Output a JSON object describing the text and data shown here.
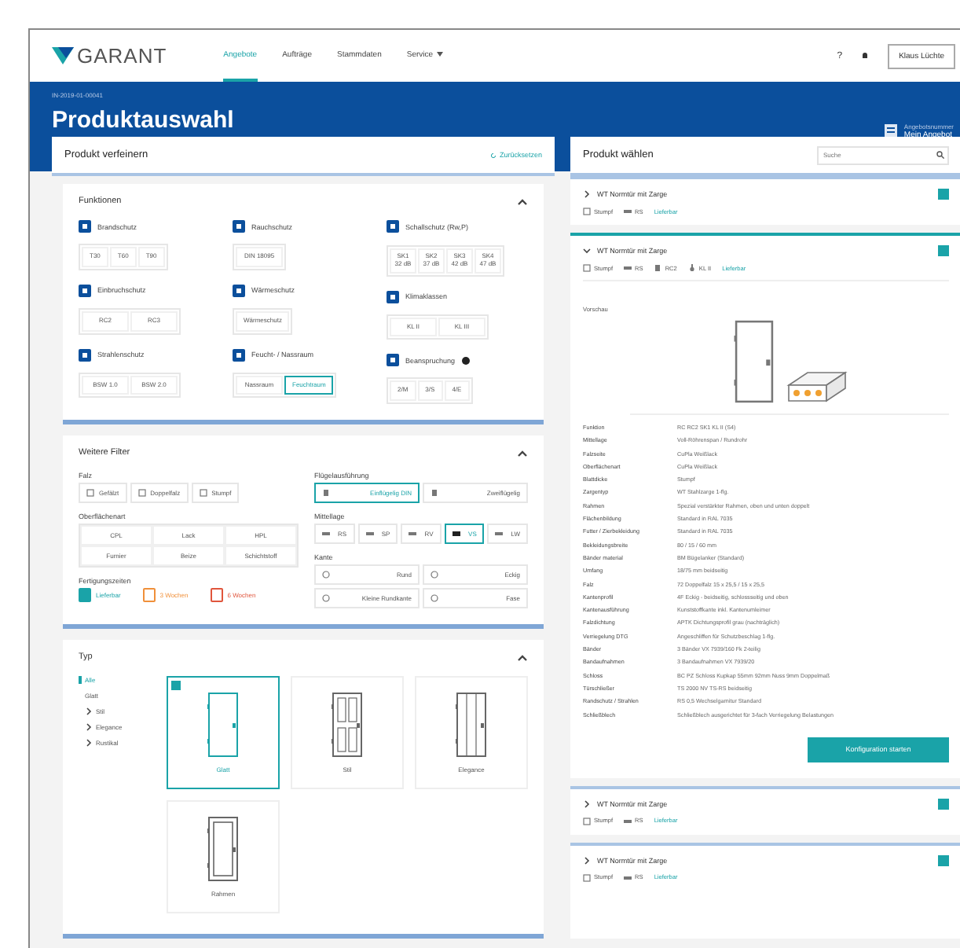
{
  "nav": {
    "logo": "GARANT",
    "items": [
      {
        "label": "Angebote",
        "selected": true,
        "menu": false
      },
      {
        "label": "Aufträge",
        "selected": false,
        "menu": false
      },
      {
        "label": "Stammdaten",
        "selected": false,
        "menu": false
      },
      {
        "label": "Service",
        "selected": false,
        "menu": true
      }
    ],
    "help": "?",
    "user": "Klaus Lüchte"
  },
  "header": {
    "breadcrumb": "IN-2019-01-00041",
    "title": "Produktauswahl",
    "offer_label": "Angebotsnummer",
    "offer_name": "Mein Angebot"
  },
  "refine": {
    "title": "Produkt verfeinern",
    "reset": "Zurücksetzen",
    "functions": {
      "title": "Funktionen",
      "expanded": true,
      "columns": [
        [
          {
            "label": "Brandschutz",
            "options": [
              {
                "label": "T30",
                "selected": false
              },
              {
                "label": "T60",
                "selected": false
              },
              {
                "label": "T90",
                "selected": false
              }
            ]
          },
          {
            "label": "Einbruchschutz",
            "options": [
              {
                "label": "RC2",
                "selected": false
              },
              {
                "label": "RC3",
                "selected": false
              }
            ]
          },
          {
            "label": "Strahlenschutz",
            "options": [
              {
                "label": "BSW 1.0",
                "selected": false
              },
              {
                "label": "BSW 2.0",
                "selected": false
              }
            ]
          }
        ],
        [
          {
            "label": "Rauchschutz",
            "options": [
              {
                "label": "DIN 18095",
                "selected": false
              }
            ]
          },
          {
            "label": "Wärmeschutz",
            "options": [
              {
                "label": "Wärmeschutz",
                "selected": false
              }
            ]
          },
          {
            "label": "Feucht- / Nassraum",
            "options": [
              {
                "label": "Nassraum",
                "selected": false
              },
              {
                "label": "Feuchtraum",
                "selected": true
              }
            ]
          }
        ],
        [
          {
            "label": "Schallschutz (Rw,P)",
            "options": [
              {
                "label": "SK1 32 dB",
                "selected": false
              },
              {
                "label": "SK2 37 dB",
                "selected": false
              },
              {
                "label": "SK3 42 dB",
                "selected": false
              },
              {
                "label": "SK4 47 dB",
                "selected": false
              }
            ]
          },
          {
            "label": "Klimaklassen",
            "options": [
              {
                "label": "KL II",
                "selected": false
              },
              {
                "label": "KL III",
                "selected": false
              }
            ]
          },
          {
            "label": "Beanspruchung",
            "info": true,
            "options": [
              {
                "label": "2/M",
                "selected": false
              },
              {
                "label": "3/S",
                "selected": false
              },
              {
                "label": "4/E",
                "selected": false
              }
            ]
          }
        ]
      ]
    },
    "more_filters": {
      "title": "Weitere Filter",
      "expanded": true,
      "falz": {
        "label": "Falz",
        "options": [
          {
            "label": "Gefälzt",
            "selected": false
          },
          {
            "label": "Doppelfalz",
            "selected": false
          },
          {
            "label": "Stumpf",
            "selected": false
          }
        ]
      },
      "surface": {
        "label": "Oberflächenart",
        "options": [
          {
            "label": "CPL",
            "selected": false
          },
          {
            "label": "Lack",
            "selected": false
          },
          {
            "label": "HPL",
            "selected": false
          },
          {
            "label": "Furnier",
            "selected": false
          },
          {
            "label": "Beize",
            "selected": false
          },
          {
            "label": "Schichtstoff",
            "selected": false
          }
        ]
      },
      "production": {
        "label": "Fertigungszeiten",
        "options": [
          {
            "label": "Lieferbar",
            "checked": true,
            "color": "#1aa3a8"
          },
          {
            "label": "3 Wochen",
            "checked": false,
            "color": "#f0903a"
          },
          {
            "label": "6 Wochen",
            "checked": false,
            "color": "#e0553c"
          }
        ]
      },
      "leaf": {
        "label": "Flügelausführung",
        "options": [
          {
            "label": "Einflügelig DIN",
            "selected": true
          },
          {
            "label": "Zweiflügelig",
            "selected": false
          }
        ]
      },
      "core": {
        "label": "Mittellage",
        "options": [
          {
            "label": "RS",
            "selected": false
          },
          {
            "label": "SP",
            "selected": false
          },
          {
            "label": "RV",
            "selected": false
          },
          {
            "label": "VS",
            "selected": true
          },
          {
            "label": "LW",
            "selected": false
          }
        ]
      },
      "edge": {
        "label": "Kante",
        "options": [
          {
            "label": "Rund",
            "selected": false
          },
          {
            "label": "Eckig",
            "selected": false
          },
          {
            "label": "Kleine Rundkante",
            "selected": false
          },
          {
            "label": "Fase",
            "selected": false
          }
        ]
      }
    },
    "type": {
      "title": "Typ",
      "expanded": true,
      "tree": [
        {
          "label": "Alle",
          "selected": true
        },
        {
          "label": "Glatt",
          "selected": false
        },
        {
          "label": "Stil",
          "selected": false,
          "expanded": false
        },
        {
          "label": "Elegance",
          "selected": false,
          "expanded": false
        },
        {
          "label": "Rustikal",
          "selected": false,
          "expanded": false
        }
      ],
      "cards": [
        {
          "label": "Glatt",
          "selected": true,
          "kind": "plain"
        },
        {
          "label": "Stil",
          "selected": false,
          "kind": "panels"
        },
        {
          "label": "Elegance",
          "selected": false,
          "kind": "grooves"
        },
        {
          "label": "Rahmen",
          "selected": false,
          "kind": "frame"
        }
      ]
    }
  },
  "products": {
    "title": "Produkt wählen",
    "search_placeholder": "Suche",
    "items": [
      {
        "name": "WT Normtür mit Zarge",
        "expanded": false,
        "tags": [
          {
            "kind": "falz",
            "label": "Stumpf"
          },
          {
            "kind": "core",
            "label": "RS"
          },
          {
            "kind": "status",
            "label": "Lieferbar"
          }
        ]
      },
      {
        "name": "WT Normtür mit Zarge",
        "expanded": true,
        "tags": [
          {
            "kind": "falz",
            "label": "Stumpf"
          },
          {
            "kind": "core",
            "label": "RS"
          },
          {
            "kind": "lock",
            "label": "RC2"
          },
          {
            "kind": "climate",
            "label": "KL II"
          },
          {
            "kind": "status",
            "label": "Lieferbar"
          }
        ],
        "preview_label": "Vorschau",
        "action": "Konfiguration starten",
        "specs": [
          {
            "label": "Funktion",
            "value": "RC RC2 SK1 KL II (S4)"
          },
          {
            "label": "Mittellage",
            "value": "Voll-Röhrenspan / Rundrohr"
          },
          {
            "label": "Falzseite",
            "value": "CuPla Weißlack"
          },
          {
            "label": "Oberflächenart",
            "value": "CuPla Weißlack"
          },
          {
            "label": "Blattdicke",
            "value": "Stumpf"
          },
          {
            "label": "Zargentyp",
            "value": "WT Stahlzarge 1-flg."
          },
          {
            "label": "Rahmen",
            "value": "Spezial verstärkter Rahmen, oben und unten doppelt"
          },
          {
            "label": "Flächenbildung",
            "value": "Standard in RAL 7035"
          },
          {
            "label": "Futter / Zierbekleidung",
            "value": "Standard in RAL 7035"
          },
          {
            "label": "Bekleidungsbreite",
            "value": "80 / 15 / 60 mm"
          },
          {
            "label": "Bänder material",
            "value": "BM Bügelanker (Standard)"
          },
          {
            "label": "Umfang",
            "value": "18/75 mm beidseitig"
          },
          {
            "label": "Falz",
            "value": "72 Doppelfalz 15 x 25,5 / 15 x 25,5"
          },
          {
            "label": "Kantenprofil",
            "value": "4F Eckig - beidseitig, schlossseitig und oben"
          },
          {
            "label": "Kantenausführung",
            "value": "Kunststoffkante inkl. Kantenumleimer"
          },
          {
            "label": "Falzdichtung",
            "value": "APTK Dichtungsprofil grau (nachträglich)"
          },
          {
            "label": "Verriegelung DTG",
            "value": "Angeschliffen für Schutzbeschlag 1-flg."
          },
          {
            "label": "Bänder",
            "value": "3 Bänder VX 7939/160 Fk 2-teilig"
          },
          {
            "label": "Bandaufnahmen",
            "value": "3 Bandaufnahmen VX 7939/20"
          },
          {
            "label": "Schloss",
            "value": "BC PZ Schloss Kupkap 55mm 92mm Nuss 9mm Doppelmaß"
          },
          {
            "label": "Türschließer",
            "value": "TS 2000 NV TS-RS beidseitig"
          },
          {
            "label": "Randschutz / Strahlen",
            "value": "RS 0,5 Wechselgarnitur Standard"
          },
          {
            "label": "Schließblech",
            "value": "Schließblech ausgerichtet für 3-fach Verriegelung Belastungen"
          }
        ]
      },
      {
        "name": "WT Normtür mit Zarge",
        "expanded": false,
        "tags": [
          {
            "kind": "falz",
            "label": "Stumpf"
          },
          {
            "kind": "core",
            "label": "RS"
          },
          {
            "kind": "status",
            "label": "Lieferbar"
          }
        ]
      },
      {
        "name": "WT Normtür mit Zarge",
        "expanded": false,
        "tags": [
          {
            "kind": "falz",
            "label": "Stumpf"
          },
          {
            "kind": "core",
            "label": "RS"
          },
          {
            "kind": "status",
            "label": "Lieferbar"
          }
        ]
      }
    ]
  }
}
